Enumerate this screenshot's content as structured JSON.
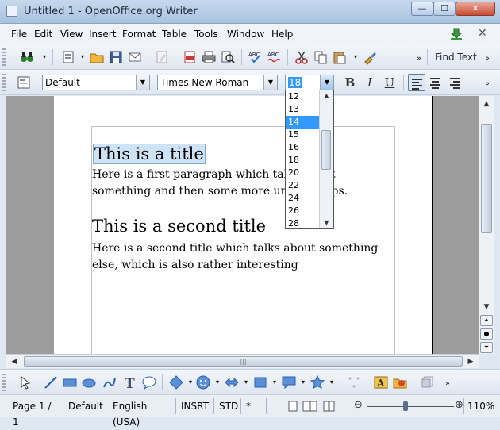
{
  "window": {
    "title": "Untitled 1 - OpenOffice.org Writer",
    "min_label": "—",
    "max_label": "☐",
    "close_label": "✕"
  },
  "menu": [
    "File",
    "Edit",
    "View",
    "Insert",
    "Format",
    "Table",
    "Tools",
    "Window",
    "Help"
  ],
  "toolbar": {
    "find_text": "Find Text",
    "icons": [
      "navigator-icon",
      "new-icon",
      "open-icon",
      "save-icon",
      "email-icon",
      "edit-file-icon",
      "export-pdf-icon",
      "print-icon",
      "page-preview-icon",
      "spellcheck-icon",
      "autospellcheck-icon",
      "cut-icon",
      "copy-icon",
      "paste-icon",
      "format-paintbrush-icon"
    ]
  },
  "formatting": {
    "style": "Default",
    "font": "Times New Roman",
    "size": "18",
    "bold": "B",
    "italic": "I",
    "underline": "U"
  },
  "size_dropdown": {
    "options": [
      "12",
      "13",
      "14",
      "15",
      "16",
      "18",
      "20",
      "22",
      "24",
      "26",
      "28"
    ],
    "highlighted": "14"
  },
  "document": {
    "title1": "This is a title",
    "para1": "Here is a first paragraph which talks about something and then some more until it stops.",
    "title2": "This is a second title",
    "para2": "Here is a second title which talks about something else, which is also rather interesting"
  },
  "status": {
    "page": "Page 1 / 1",
    "style": "Default",
    "language": "English (USA)",
    "insert_mode": "INSRT",
    "selection_mode": "STD",
    "modified": "*",
    "zoom": "110%"
  },
  "colors": {
    "highlight": "#3399ff",
    "selection_bg": "#cfe3f7"
  }
}
